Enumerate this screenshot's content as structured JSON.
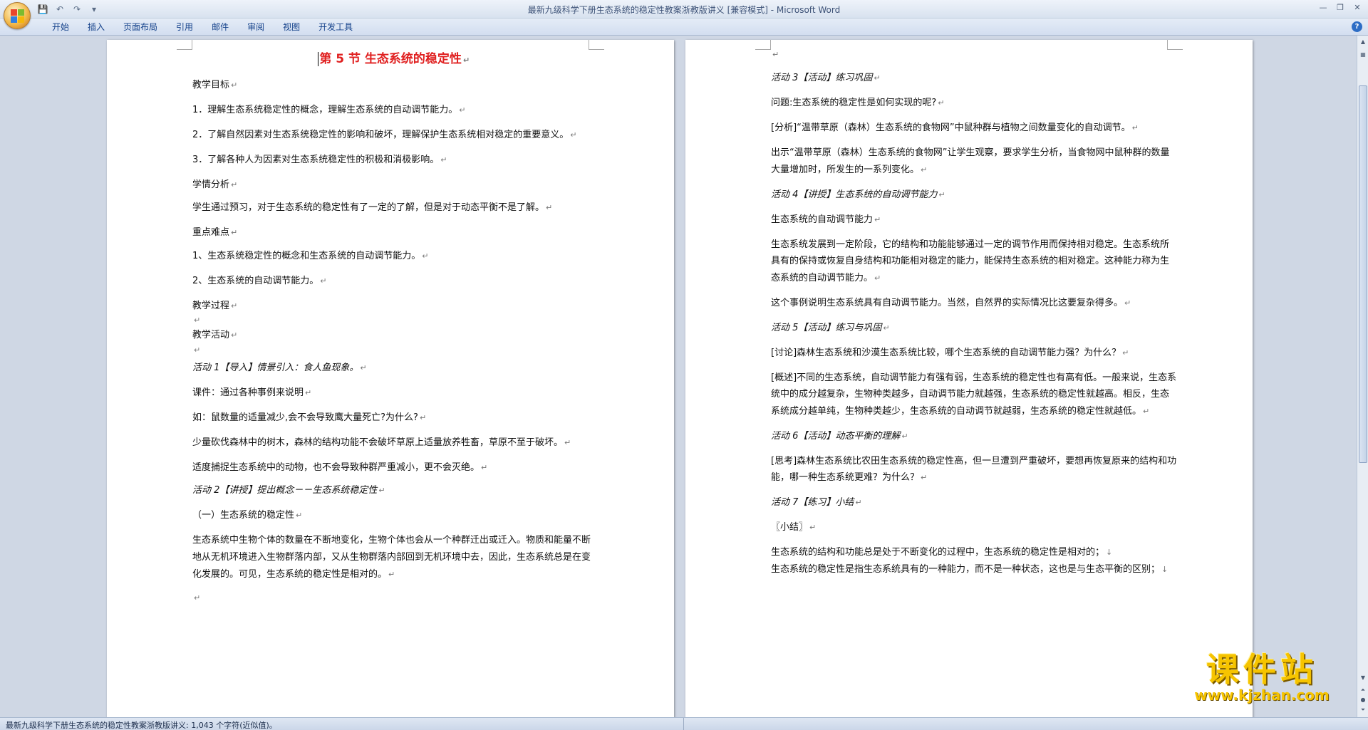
{
  "window": {
    "title": "最新九级科学下册生态系统的稳定性教案浙教版讲义 [兼容模式] - Microsoft Word"
  },
  "quick_access": [
    "save-icon",
    "undo-icon",
    "redo-icon",
    "customize-icon"
  ],
  "ribbon": {
    "tabs": [
      "开始",
      "插入",
      "页面布局",
      "引用",
      "邮件",
      "审阅",
      "视图",
      "开发工具"
    ]
  },
  "left_page": {
    "title": "第 5 节  生态系统的稳定性",
    "paragraphs": [
      "教学目标",
      "1．理解生态系统稳定性的概念，理解生态系统的自动调节能力。",
      "2．了解自然因素对生态系统稳定性的影响和破坏，理解保护生态系统相对稳定的重要意义。",
      "3．了解各种人为因素对生态系统稳定性的积极和消极影响。",
      "学情分析",
      "学生通过预习，对于生态系统的稳定性有了一定的了解，但是对于动态平衡不是了解。",
      "重点难点",
      "1、生态系统稳定性的概念和生态系统的自动调节能力。",
      "2、生态系统的自动调节能力。",
      "教学过程",
      "",
      "教学活动",
      "",
      "活动 1【导入】情景引入：食人鱼现象。",
      "课件：通过各种事例来说明",
      "如：鼠数量的适量减少,会不会导致鹰大量死亡?为什么?",
      "少量砍伐森林中的树木，森林的结构功能不会破坏草原上适量放养牲畜，草原不至于破坏。",
      "适度捕捉生态系统中的动物，也不会导致种群严重减小，更不会灭绝。",
      "活动 2【讲授】提出概念－－生态系统稳定性",
      "（一）生态系统的稳定性",
      "生态系统中生物个体的数量在不断地变化，生物个体也会从一个种群迁出或迁入。物质和能量不断地从无机环境进入生物群落内部，又从生物群落内部回到无机环境中去，因此，生态系统总是在变化发展的。可见，生态系统的稳定性是相对的。",
      ""
    ]
  },
  "right_page": {
    "paragraphs": [
      "",
      "活动 3【活动】练习巩固",
      "问题:生态系统的稳定性是如何实现的呢?",
      "[分析]“温带草原（森林）生态系统的食物网”中鼠种群与植物之间数量变化的自动调节。",
      "出示“温带草原（森林）生态系统的食物网”让学生观察，要求学生分析，当食物网中鼠种群的数量大量增加时，所发生的一系列变化。",
      "活动 4【讲授】生态系统的自动调节能力",
      "生态系统的自动调节能力",
      "生态系统发展到一定阶段，它的结构和功能能够通过一定的调节作用而保持相对稳定。生态系统所具有的保持或恢复自身结构和功能相对稳定的能力，能保持生态系统的相对稳定。这种能力称为生态系统的自动调节能力。",
      "这个事例说明生态系统具有自动调节能力。当然，自然界的实际情况比这要复杂得多。",
      "活动 5【活动】练习与巩固",
      "[讨论]森林生态系统和沙漠生态系统比较，哪个生态系统的自动调节能力强？为什么？",
      "[概述]不同的生态系统，自动调节能力有强有弱，生态系统的稳定性也有高有低。一般来说，生态系统中的成分越复杂，生物种类越多，自动调节能力就越强，生态系统的稳定性就越高。相反，生态系统成分越单纯，生物种类越少，生态系统的自动调节就越弱，生态系统的稳定性就越低。",
      "活动 6【活动】动态平衡的理解",
      "[思考]森林生态系统比农田生态系统的稳定性高，但一旦遭到严重破坏，要想再恢复原来的结构和功能，哪一种生态系统更难？为什么？",
      "活动 7【练习】小结",
      "〖小结〗",
      "生态系统的结构和功能总是处于不断变化的过程中，生态系统的稳定性是相对的；",
      "生态系统的稳定性是指生态系统具有的一种能力，而不是一种状态，这也是与生态平衡的区别；"
    ]
  },
  "status_bar": {
    "text": "最新九级科学下册生态系统的稳定性教案浙教版讲义: 1,043 个字符(近似值)。"
  },
  "watermark": {
    "text": "课件站",
    "url": "www.kjzhan.com"
  },
  "colors": {
    "title_red": "#e02020",
    "watermark_yellow": "#f6c400",
    "ribbon_blue": "#15428b"
  }
}
